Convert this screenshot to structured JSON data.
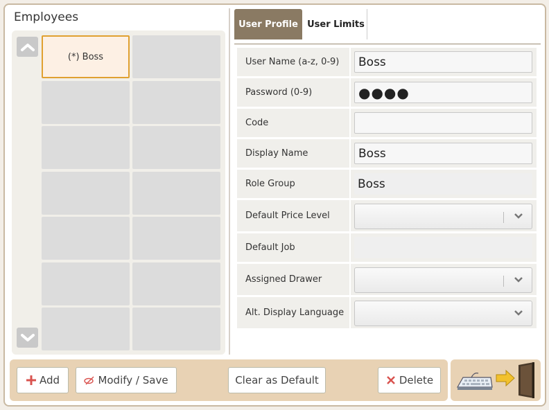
{
  "employees": {
    "title": "Employees",
    "selected_label": "(*) Boss"
  },
  "tabs": {
    "user_profile": "User Profile",
    "user_limits": "User Limits"
  },
  "form": {
    "user_name_label": "User Name (a-z, 0-9)",
    "user_name_value": "Boss",
    "password_label": "Password (0-9)",
    "password_value": "●●●●",
    "code_label": "Code",
    "code_value": "",
    "display_name_label": "Display Name",
    "display_name_value": "Boss",
    "role_group_label": "Role Group",
    "role_group_value": "Boss",
    "default_price_level_label": "Default Price Level",
    "default_price_level_value": "",
    "default_job_label": "Default Job",
    "default_job_value": "",
    "assigned_drawer_label": "Assigned Drawer",
    "assigned_drawer_value": "",
    "alt_display_language_label": "Alt. Display Language",
    "alt_display_language_value": ""
  },
  "buttons": {
    "add": "Add",
    "modify_save": "Modify / Save",
    "clear_default": "Clear as Default",
    "delete": "Delete"
  },
  "colors": {
    "accent_tab": "#8a7a63",
    "selected_border": "#e0a030",
    "bottom_bar": "#e8d2b4",
    "add_icon": "#d9534f",
    "delete_icon": "#d9534f"
  },
  "icons": {
    "scroll_up": "chevron-up-icon",
    "scroll_down": "chevron-down-icon",
    "add": "plus-icon",
    "modify": "edit-icon",
    "delete": "x-icon",
    "exit": "keyboard-exit-door-icon"
  }
}
